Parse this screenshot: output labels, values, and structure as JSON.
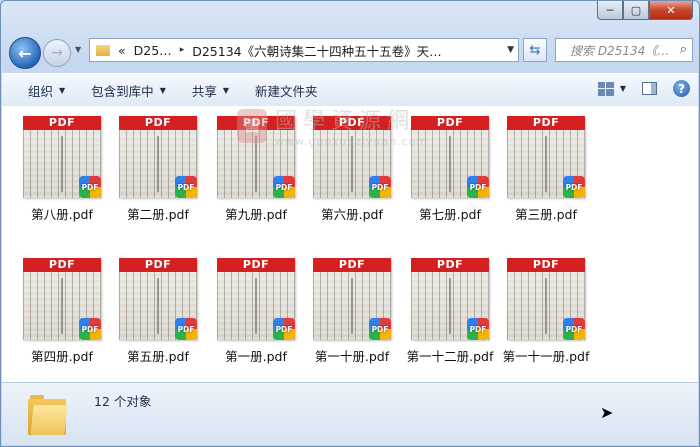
{
  "window": {
    "caption_buttons": [
      "─",
      "▢",
      "✕"
    ]
  },
  "nav": {
    "address_segments": [
      "«",
      "D25…",
      "▸",
      "D25134《六朝诗集二十四种五十五卷》天…"
    ],
    "search_placeholder": "搜索 D25134《…"
  },
  "toolbar": {
    "organize": "组织",
    "include_in_library": "包含到库中",
    "share": "共享",
    "new_folder": "新建文件夹"
  },
  "files": [
    {
      "name": "第八册.pdf",
      "thumb_label": "PDF",
      "badge": "PDF"
    },
    {
      "name": "第二册.pdf",
      "thumb_label": "PDF",
      "badge": "PDF"
    },
    {
      "name": "第九册.pdf",
      "thumb_label": "PDF",
      "badge": "PDF"
    },
    {
      "name": "第六册.pdf",
      "thumb_label": "PDF",
      "badge": "PDF"
    },
    {
      "name": "第七册.pdf",
      "thumb_label": "PDF",
      "badge": "PDF"
    },
    {
      "name": "第三册.pdf",
      "thumb_label": "PDF",
      "badge": "PDF"
    },
    {
      "name": "第四册.pdf",
      "thumb_label": "PDF",
      "badge": "PDF"
    },
    {
      "name": "第五册.pdf",
      "thumb_label": "PDF",
      "badge": "PDF"
    },
    {
      "name": "第一册.pdf",
      "thumb_label": "PDF",
      "badge": "PDF"
    },
    {
      "name": "第一十册.pdf",
      "thumb_label": "PDF",
      "badge": "PDF"
    },
    {
      "name": "第一十二册.pdf",
      "thumb_label": "PDF",
      "badge": "PDF"
    },
    {
      "name": "第一十一册.pdf",
      "thumb_label": "PDF",
      "badge": "PDF"
    }
  ],
  "watermark": {
    "seal": "國",
    "text": "國學資源網",
    "url": "www.guoxueziyuan.com"
  },
  "status": {
    "count": "12 个对象"
  }
}
